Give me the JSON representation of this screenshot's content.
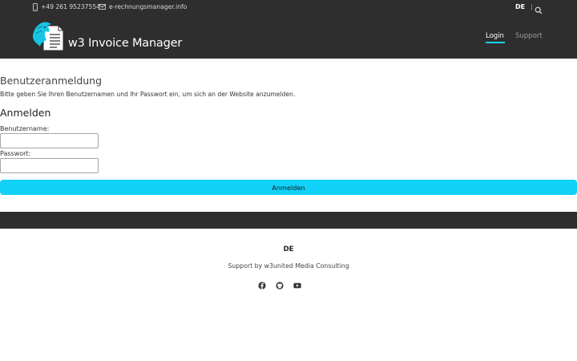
{
  "topbar": {
    "phone": "+49 261 95237554",
    "email": "e-rechnungsmanager.info",
    "language": "DE",
    "separator": "|",
    "brand_name": "w3 Invoice Manager"
  },
  "nav": {
    "items": [
      {
        "label": "Login",
        "active": true
      },
      {
        "label": "Support",
        "active": false
      }
    ]
  },
  "main": {
    "page_title": "Benutzeranmeldung",
    "intro": "Bitte geben Sie Ihren Benutzernamen und Ihr Passwort ein, um sich an der Website anzumelden.",
    "form_title": "Anmelden",
    "username_label": "Benutzername:",
    "username_value": "",
    "password_label": "Passwort:",
    "password_value": "",
    "submit_label": "Anmelden"
  },
  "footer": {
    "language": "DE",
    "support_text": "Support by w3united Media Consulting",
    "social_icons": [
      "facebook-icon",
      "github-icon",
      "youtube-icon"
    ]
  },
  "colors": {
    "header_bg": "#2e2e2e",
    "accent": "#12d1f7",
    "nav_active_underline": "#19d0e8",
    "text_dark": "#333333"
  }
}
